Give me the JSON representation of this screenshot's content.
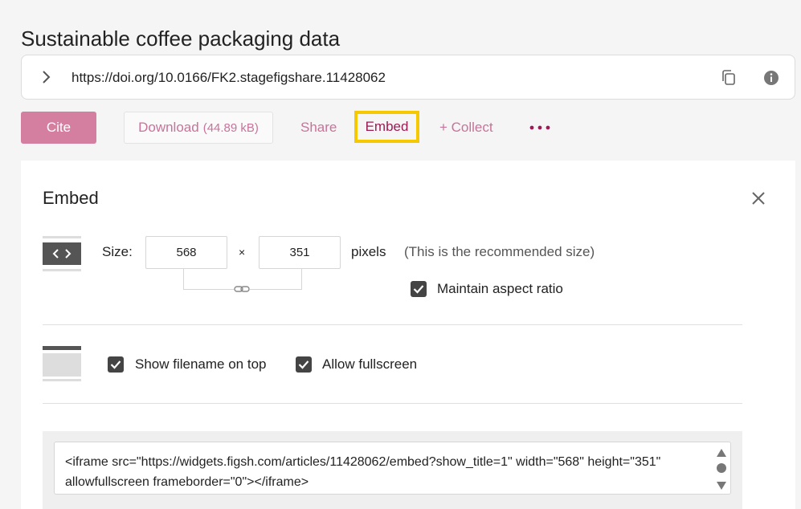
{
  "page": {
    "title": "Sustainable coffee packaging data"
  },
  "doi": {
    "url": "https://doi.org/10.0166/FK2.stagefigshare.11428062"
  },
  "actions": {
    "cite": "Cite",
    "download": "Download",
    "download_size": "(44.89 kB)",
    "share": "Share",
    "embed": "Embed",
    "collect": "+ Collect"
  },
  "embed_panel": {
    "title": "Embed",
    "size_label": "Size:",
    "width": "568",
    "times": "×",
    "height": "351",
    "pixels_label": "pixels",
    "recommended_note": "(This is the recommended size)",
    "maintain_aspect_ratio": {
      "label": "Maintain aspect ratio",
      "checked": true
    },
    "show_filename": {
      "label": "Show filename on top",
      "checked": true
    },
    "allow_fullscreen": {
      "label": "Allow fullscreen",
      "checked": true
    },
    "embed_code": "<iframe src=\"https://widgets.figsh.com/articles/11428062/embed?show_title=1\" width=\"568\" height=\"351\" allowfullscreen frameborder=\"0\"></iframe>"
  },
  "colors": {
    "accent": "#d47fa0",
    "link": "#c8739a",
    "active_link": "#9b1c55",
    "highlight": "#f6c800",
    "checkbox": "#444444"
  }
}
